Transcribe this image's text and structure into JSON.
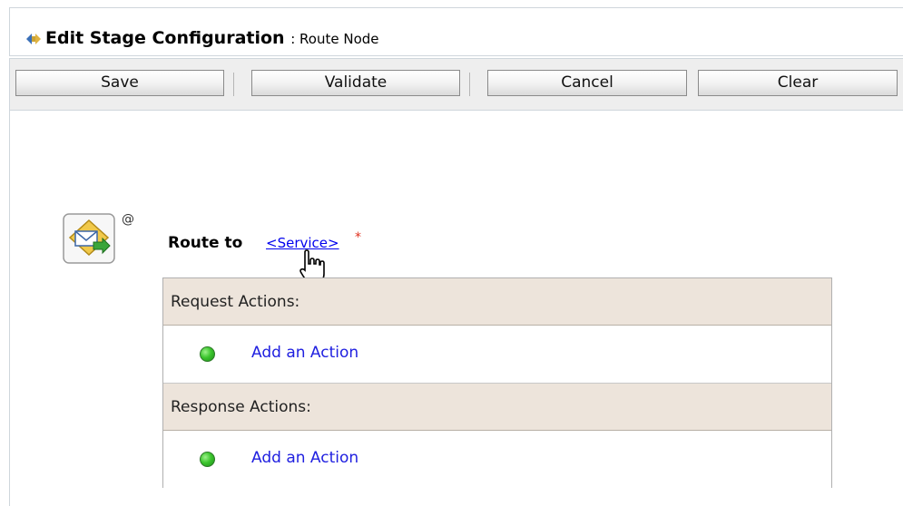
{
  "header": {
    "title": "Edit Stage Configuration",
    "subtitle": ": Route Node",
    "icon": "stage-config-icon"
  },
  "toolbar": {
    "buttons": [
      {
        "label": "Save"
      },
      {
        "label": "Validate"
      },
      {
        "label": "Cancel"
      },
      {
        "label": "Clear"
      }
    ]
  },
  "route": {
    "label": "Route to",
    "service_link": "<Service>",
    "required_marker": "*",
    "at_marker": "@",
    "icon": "route-node-icon"
  },
  "request_actions": {
    "heading": "Request Actions:",
    "add_label": "Add an Action"
  },
  "response_actions": {
    "heading": "Response Actions:",
    "add_label": "Add an Action"
  },
  "colors": {
    "section_header_bg": "#ede4db",
    "link": "#0000ee",
    "required": "#e0301e",
    "status_dot": "#3cc52e"
  }
}
